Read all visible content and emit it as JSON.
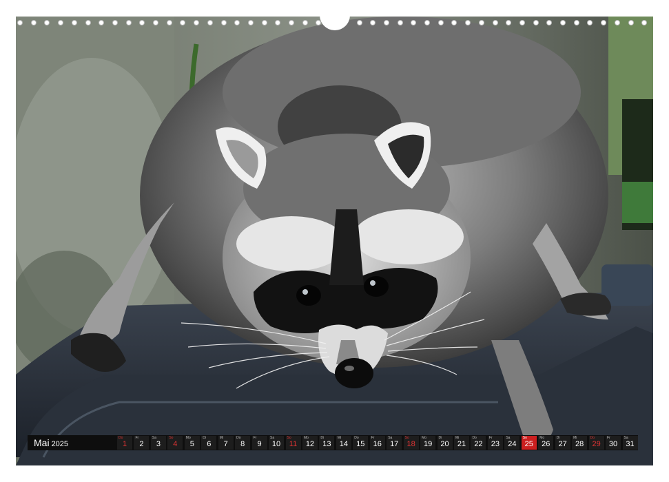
{
  "calendar": {
    "month": "Mai",
    "year": "2025",
    "days": [
      {
        "n": "1",
        "wd": "Do",
        "type": "red"
      },
      {
        "n": "2",
        "wd": "Fr",
        "type": ""
      },
      {
        "n": "3",
        "wd": "Sa",
        "type": ""
      },
      {
        "n": "4",
        "wd": "So",
        "type": "red"
      },
      {
        "n": "5",
        "wd": "Mo",
        "type": ""
      },
      {
        "n": "6",
        "wd": "Di",
        "type": ""
      },
      {
        "n": "7",
        "wd": "Mi",
        "type": ""
      },
      {
        "n": "8",
        "wd": "Do",
        "type": ""
      },
      {
        "n": "9",
        "wd": "Fr",
        "type": ""
      },
      {
        "n": "10",
        "wd": "Sa",
        "type": ""
      },
      {
        "n": "11",
        "wd": "So",
        "type": "red"
      },
      {
        "n": "12",
        "wd": "Mo",
        "type": ""
      },
      {
        "n": "13",
        "wd": "Di",
        "type": ""
      },
      {
        "n": "14",
        "wd": "Mi",
        "type": ""
      },
      {
        "n": "15",
        "wd": "Do",
        "type": ""
      },
      {
        "n": "16",
        "wd": "Fr",
        "type": ""
      },
      {
        "n": "17",
        "wd": "Sa",
        "type": ""
      },
      {
        "n": "18",
        "wd": "So",
        "type": "red"
      },
      {
        "n": "19",
        "wd": "Mo",
        "type": ""
      },
      {
        "n": "20",
        "wd": "Di",
        "type": ""
      },
      {
        "n": "21",
        "wd": "Mi",
        "type": ""
      },
      {
        "n": "22",
        "wd": "Do",
        "type": ""
      },
      {
        "n": "23",
        "wd": "Fr",
        "type": ""
      },
      {
        "n": "24",
        "wd": "Sa",
        "type": ""
      },
      {
        "n": "25",
        "wd": "So",
        "type": "hol"
      },
      {
        "n": "26",
        "wd": "Mo",
        "type": ""
      },
      {
        "n": "27",
        "wd": "Di",
        "type": ""
      },
      {
        "n": "28",
        "wd": "Mi",
        "type": ""
      },
      {
        "n": "29",
        "wd": "Do",
        "type": "red"
      },
      {
        "n": "30",
        "wd": "Fr",
        "type": ""
      },
      {
        "n": "31",
        "wd": "Sa",
        "type": ""
      }
    ]
  },
  "colors": {
    "bar": "#0e0e0e",
    "cell": "#1d1d1d",
    "sunday_red": "#e03434",
    "holiday_fill": "#cc1f1f"
  },
  "icons": [
    "spiral-binding-ring",
    "hanger-notch"
  ]
}
